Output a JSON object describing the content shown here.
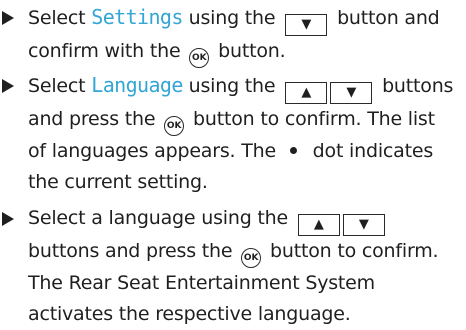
{
  "steps": [
    {
      "parts": [
        "Select ",
        "Settings",
        " using the ",
        " button and confirm with the ",
        " button."
      ],
      "keys": [
        "▼"
      ],
      "ok_label": "OK"
    },
    {
      "parts": [
        "Select ",
        "Language",
        " using the ",
        " buttons and press the ",
        " button to confirm. The list of languages appears. The ",
        " dot indicates the current setting."
      ],
      "keys": [
        "▲",
        "▼"
      ],
      "ok_label": "OK"
    },
    {
      "parts": [
        "Select a language using the ",
        " buttons and press the ",
        " button to confirm. The Rear Seat Entertainment System activates the respective language."
      ],
      "keys": [
        "▲",
        "▼"
      ],
      "ok_label": "OK"
    }
  ],
  "colors": {
    "highlight": "#33a6d6",
    "text": "#1f1f1f"
  },
  "icons": {
    "bullet": "right-triangle-bullet-icon",
    "ok": "ok-button-icon",
    "dot": "filled-dot-icon"
  }
}
